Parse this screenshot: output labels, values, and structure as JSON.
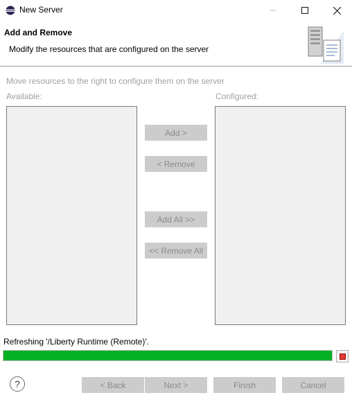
{
  "window": {
    "title": "New Server",
    "icons": {
      "app": "eclipse-icon",
      "minimize": "minimize-icon",
      "maximize": "maximize-icon",
      "close": "close-icon"
    }
  },
  "header": {
    "title": "Add and Remove",
    "description": "Modify the resources that are configured on the server",
    "icon": "server-wizard-icon"
  },
  "body": {
    "instructions": "Move resources to the right to configure them on the server",
    "available_label": "Available:",
    "configured_label": "Configured:",
    "available_items": [],
    "configured_items": [],
    "buttons": {
      "add": "Add >",
      "remove": "< Remove",
      "add_all": "Add All >>",
      "remove_all": "<< Remove All"
    }
  },
  "status": {
    "text": "Refreshing '/Liberty Runtime (Remote)'.",
    "progress": 1.0,
    "progress_color": "#06b025",
    "stop_icon": "stop-icon"
  },
  "footer": {
    "help_icon": "help-icon",
    "back": "< Back",
    "next": "Next >",
    "finish": "Finish",
    "cancel": "Cancel"
  }
}
